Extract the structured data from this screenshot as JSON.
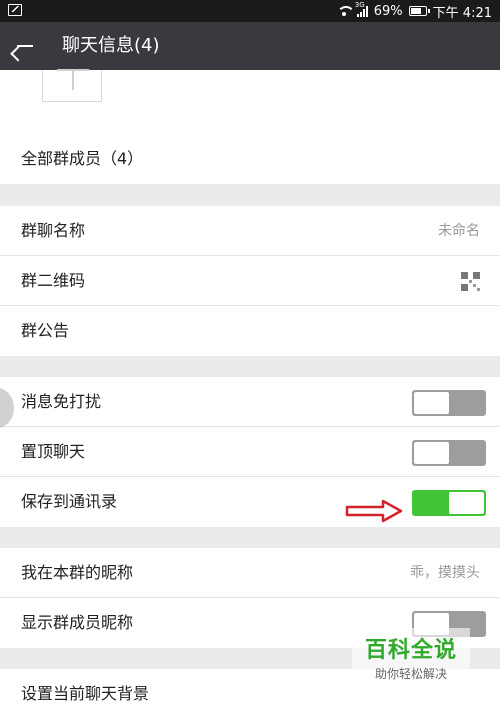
{
  "status_bar": {
    "battery": "69%",
    "time": "下午 4:21",
    "network": "3G"
  },
  "header": {
    "title": "聊天信息(4)"
  },
  "sections": {
    "members": {
      "label": "全部群成员（4）"
    },
    "group_name": {
      "label": "群聊名称",
      "value": "未命名"
    },
    "qr_code": {
      "label": "群二维码"
    },
    "announcement": {
      "label": "群公告"
    },
    "mute": {
      "label": "消息免打扰",
      "state": "off"
    },
    "pin": {
      "label": "置顶聊天",
      "state": "off"
    },
    "save_contacts": {
      "label": "保存到通讯录",
      "state": "on"
    },
    "my_nickname": {
      "label": "我在本群的昵称",
      "value": "乖，摸摸头"
    },
    "show_nicknames": {
      "label": "显示群成员昵称",
      "state": "off"
    },
    "background": {
      "label": "设置当前聊天背景"
    }
  },
  "watermark": {
    "title": "百科全说",
    "subtitle": "助你轻松解决"
  },
  "colors": {
    "appbar": "#393a3f",
    "toggle_on": "#3fc536",
    "toggle_off": "#9c9e9b",
    "arrow": "#d2232a"
  }
}
